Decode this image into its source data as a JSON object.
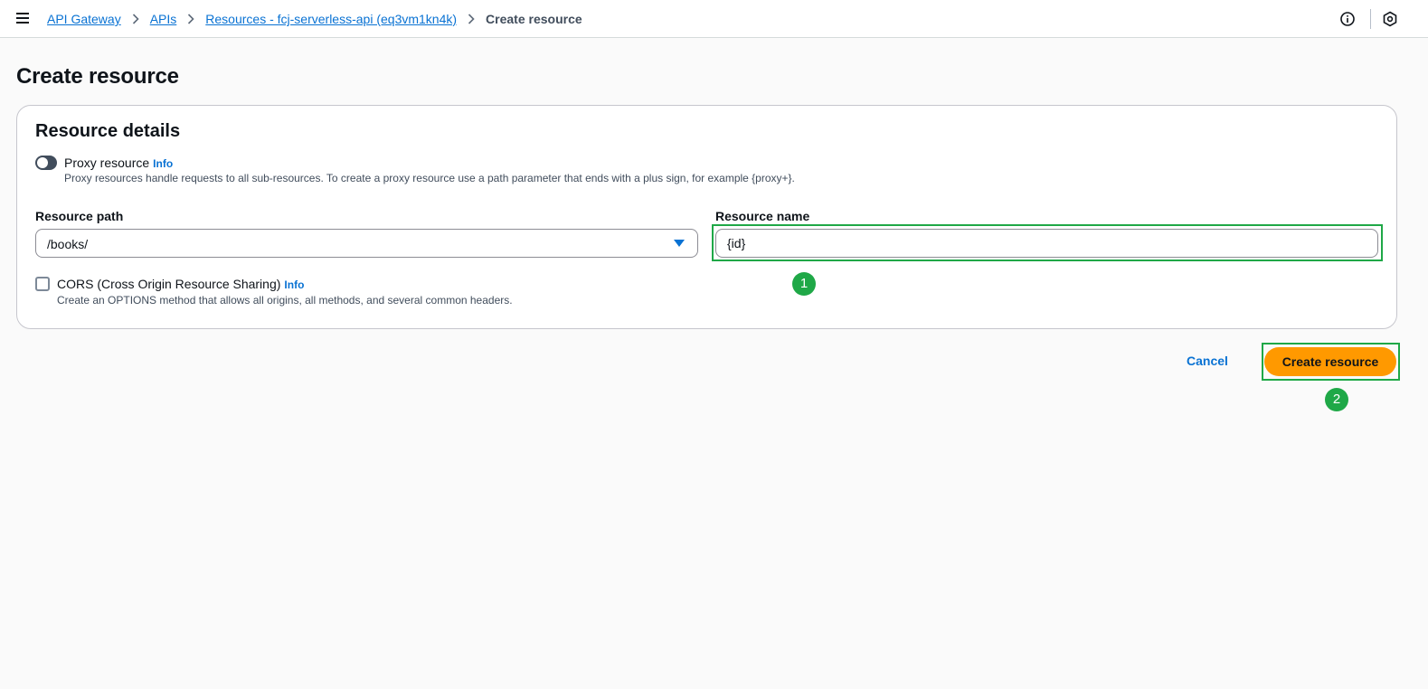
{
  "breadcrumbs": [
    {
      "label": "API Gateway"
    },
    {
      "label": "APIs"
    },
    {
      "label": "Resources - fcj-serverless-api (eq3vm1kn4k)"
    },
    {
      "label": "Create resource"
    }
  ],
  "page_title": "Create resource",
  "details": {
    "title": "Resource details",
    "proxy": {
      "label": "Proxy resource",
      "info": "Info",
      "description": "Proxy resources handle requests to all sub-resources. To create a proxy resource use a path parameter that ends with a plus sign, for example {proxy+}.",
      "enabled": false
    },
    "resource_path": {
      "label": "Resource path",
      "value": "/books/"
    },
    "resource_name": {
      "label": "Resource name",
      "value": "{id}"
    },
    "cors": {
      "label": "CORS (Cross Origin Resource Sharing)",
      "info": "Info",
      "description": "Create an OPTIONS method that allows all origins, all methods, and several common headers.",
      "checked": false
    }
  },
  "actions": {
    "cancel": "Cancel",
    "create": "Create resource"
  },
  "annotations": {
    "step1": "1",
    "step2": "2"
  },
  "colors": {
    "primary_button": "#ff9900",
    "link": "#0972d3",
    "highlight": "#1fa847"
  }
}
